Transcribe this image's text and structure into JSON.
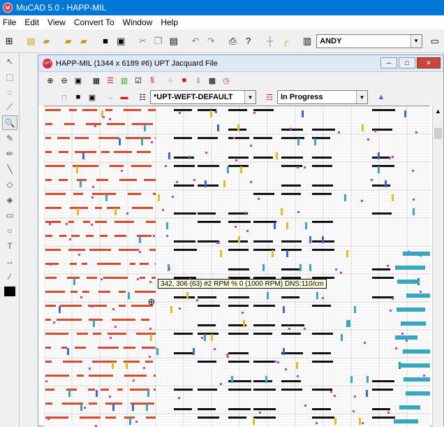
{
  "window": {
    "title": "MuCAD 5.0  -  HAPP-MIL",
    "app_icon": "mucad-logo-icon"
  },
  "menu": [
    "File",
    "Edit",
    "View",
    "Convert To",
    "Window",
    "Help"
  ],
  "toolbar": {
    "user_combo_value": "ANDY",
    "icons": [
      "weave-icon",
      "new-file-icon",
      "open-folder-icon",
      "open-file-icon",
      "open-folder-2-icon",
      "save-icon",
      "save-all-icon",
      "cut-icon",
      "copy-icon",
      "paste-icon",
      "undo-icon",
      "redo-icon",
      "print-icon",
      "help-pointer-icon",
      "grid-icon",
      "grid-corner-icon",
      "layout-icon",
      "screen-icon"
    ]
  },
  "child_window": {
    "title": "HAPP-MIL (1344 x 6189 #6) UPT Jacquard File",
    "icon": "upt-logo-icon",
    "weft_combo_value": "*UPT-WEFT-DEFAULT",
    "status_combo_value": "In Progress"
  },
  "tooltip": "342, 306 (63) #2  RPM % 0 (1000 RPM) DNS:110/cm",
  "colors": {
    "titlebar": "#0078d7",
    "grid_red": "#d94a2a",
    "grid_black": "#111111",
    "grid_blue": "#3a6ad0",
    "grid_teal": "#38a8c0",
    "grid_yellow": "#e0c020",
    "grid_pink": "#d040c0",
    "grid_line": "#c8c8c8"
  }
}
